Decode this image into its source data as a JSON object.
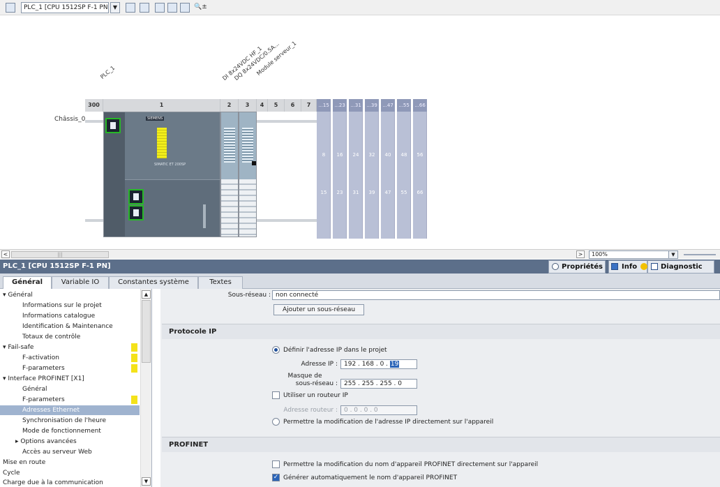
{
  "toolbar": {
    "device_select": "PLC_1 [CPU 1512SP F-1 PN]",
    "zoom_glyph": "🔍±"
  },
  "device_view": {
    "plc_label": "PLC_1",
    "module_labels": [
      "DI 8x24VDC HF_1",
      "DQ 8x24VDC/0.5A...",
      "Module serveur_1"
    ],
    "chassis_label": "Châssis_0",
    "slots": [
      "300",
      "1",
      "2",
      "3",
      "4",
      "5",
      "6",
      "7"
    ],
    "ext_top": [
      "...15",
      "...23",
      "...31",
      "...39",
      "...47",
      "...55",
      "...66"
    ],
    "ext_mid": [
      "8",
      "16",
      "24",
      "32",
      "40",
      "48",
      "56"
    ],
    "ext_bottom": [
      "15",
      "23",
      "31",
      "39",
      "47",
      "55",
      "66"
    ],
    "cpu_brand": "SIEMENS",
    "cpu_model": "SIMATIC ET 200SP"
  },
  "scroll": {
    "zoom_value": "100%"
  },
  "inspector": {
    "title": "PLC_1 [CPU 1512SP F-1 PN]",
    "properties_tab": "Propriétés",
    "info_tab": "Info",
    "diagnostic_tab": "Diagnostic"
  },
  "tabs": [
    "Général",
    "Variable IO",
    "Constantes système",
    "Textes"
  ],
  "nav": [
    {
      "label": "▾ Général",
      "indent": 0
    },
    {
      "label": "Informations sur le projet",
      "indent": 1
    },
    {
      "label": "Informations catalogue",
      "indent": 1
    },
    {
      "label": "Identification & Maintenance",
      "indent": 1
    },
    {
      "label": "Totaux de contrôle",
      "indent": 1
    },
    {
      "label": "▾ Fail-safe",
      "indent": 0
    },
    {
      "label": "F-activation",
      "indent": 1
    },
    {
      "label": "F-parameters",
      "indent": 1
    },
    {
      "label": "▾ Interface PROFINET [X1]",
      "indent": 0
    },
    {
      "label": "Général",
      "indent": 1
    },
    {
      "label": "F-parameters",
      "indent": 1
    },
    {
      "label": "Adresses Ethernet",
      "indent": 1
    },
    {
      "label": "Synchronisation de l'heure",
      "indent": 1
    },
    {
      "label": "Mode de fonctionnement",
      "indent": 1
    },
    {
      "label": "▸ Options avancées",
      "indent": 1
    },
    {
      "label": "Accès au serveur Web",
      "indent": 1
    },
    {
      "label": "Mise en route",
      "indent": 0
    },
    {
      "label": "Cycle",
      "indent": 0
    },
    {
      "label": "Charge due à la communication",
      "indent": 0
    }
  ],
  "props": {
    "subnet_label": "Sous-réseau :",
    "subnet_value": "non connecté",
    "add_subnet_button": "Ajouter un sous-réseau",
    "ip_section": "Protocole IP",
    "define_ip_option": "Définir l'adresse IP dans le projet",
    "ip_label": "Adresse IP :",
    "ip_value": [
      "192",
      "168",
      "0",
      "19"
    ],
    "mask_label_1": "Masque de",
    "mask_label_2": "sous-réseau :",
    "mask_value": "255 . 255 . 255 . 0",
    "router_checkbox": "Utiliser un routeur IP",
    "router_label": "Adresse routeur :",
    "router_value": "0 . 0 . 0 . 0",
    "modify_on_device_option": "Permettre la modification de l'adresse IP directement sur l'appareil",
    "profinet_section": "PROFINET",
    "profinet_name_modify": "Permettre la modification du nom d'appareil PROFINET directement sur l'appareil",
    "profinet_name_auto": "Générer automatiquement le nom d'appareil PROFINET"
  }
}
